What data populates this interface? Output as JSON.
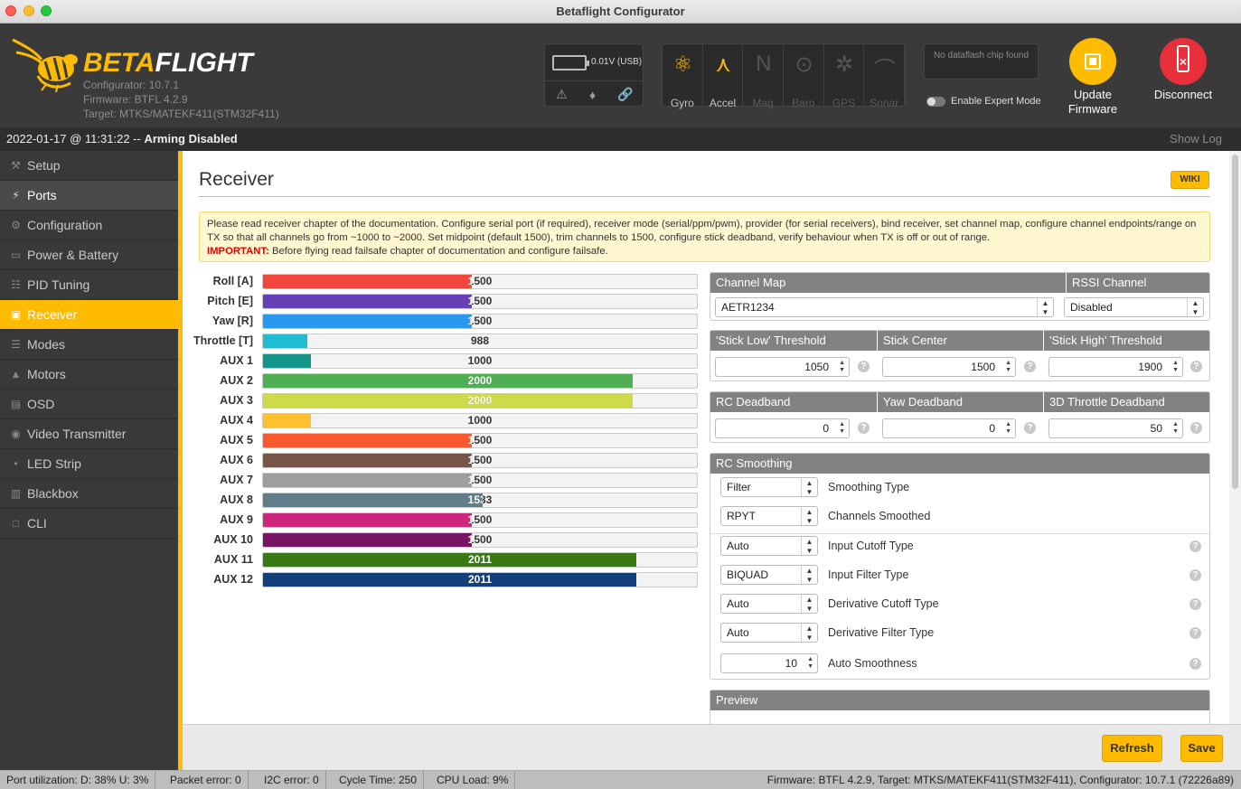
{
  "window": {
    "title": "Betaflight Configurator"
  },
  "header": {
    "brand_a": "BETA",
    "brand_b": "FLIGHT",
    "configurator": "Configurator: 10.7.1",
    "firmware": "Firmware: BTFL 4.2.9",
    "target": "Target: MTKS/MATEKF411(STM32F411)",
    "battery": "0.01V (USB)",
    "sensors": [
      {
        "label": "Gyro",
        "icon": "gyro-icon",
        "active": true
      },
      {
        "label": "Accel",
        "icon": "accel-icon",
        "active": true
      },
      {
        "label": "Mag",
        "icon": "mag-icon",
        "active": false
      },
      {
        "label": "Baro",
        "icon": "baro-icon",
        "active": false
      },
      {
        "label": "GPS",
        "icon": "gps-icon",
        "active": false
      },
      {
        "label": "Sonar",
        "icon": "sonar-icon",
        "active": false
      }
    ],
    "dataflash": "No dataflash chip found",
    "expert_mode": "Enable Expert Mode",
    "update_firmware": "Update Firmware",
    "disconnect": "Disconnect"
  },
  "status": {
    "timestamp": "2022-01-17 @ 11:31:22 --",
    "state": "Arming Disabled",
    "show_log": "Show Log"
  },
  "sidebar": {
    "items": [
      {
        "label": "Setup",
        "icon": "wrench-icon",
        "state": "normal"
      },
      {
        "label": "Ports",
        "icon": "plug-icon",
        "state": "hover"
      },
      {
        "label": "Configuration",
        "icon": "gear-icon",
        "state": "normal"
      },
      {
        "label": "Power & Battery",
        "icon": "battery-icon",
        "state": "normal"
      },
      {
        "label": "PID Tuning",
        "icon": "pid-icon",
        "state": "normal"
      },
      {
        "label": "Receiver",
        "icon": "receiver-icon",
        "state": "active"
      },
      {
        "label": "Modes",
        "icon": "modes-icon",
        "state": "normal"
      },
      {
        "label": "Motors",
        "icon": "motor-icon",
        "state": "normal"
      },
      {
        "label": "OSD",
        "icon": "osd-icon",
        "state": "normal"
      },
      {
        "label": "Video Transmitter",
        "icon": "vtx-icon",
        "state": "normal"
      },
      {
        "label": "LED Strip",
        "icon": "led-icon",
        "state": "normal"
      },
      {
        "label": "Blackbox",
        "icon": "blackbox-icon",
        "state": "normal"
      },
      {
        "label": "CLI",
        "icon": "cli-icon",
        "state": "normal"
      }
    ]
  },
  "page": {
    "title": "Receiver",
    "wiki": "WIKI",
    "note_line1": "Please read receiver chapter of the documentation. Configure serial port (if required), receiver mode (serial/ppm/pwm), provider (for serial receivers), bind receiver, set channel map, configure channel endpoints/range on TX so that all channels go from ~1000 to ~2000. Set midpoint (default 1500), trim channels to 1500, configure stick deadband, verify behaviour when TX is off or out of range.",
    "note_important": "IMPORTANT:",
    "note_line2": "Before flying read failsafe chapter of documentation and configure failsafe."
  },
  "channels": [
    {
      "label": "Roll [A]",
      "value": 1500,
      "display": "1500",
      "color": "#f1453d"
    },
    {
      "label": "Pitch [E]",
      "value": 1500,
      "display": "1500",
      "color": "#673fb4"
    },
    {
      "label": "Yaw [R]",
      "value": 1500,
      "display": "1500",
      "color": "#2b98f0"
    },
    {
      "label": "Throttle [T]",
      "value": 988,
      "display": "988",
      "color": "#1fbcd2"
    },
    {
      "label": "AUX 1",
      "value": 1000,
      "display": "1000",
      "color": "#159588"
    },
    {
      "label": "AUX 2",
      "value": 2000,
      "display": "2000",
      "color": "#50ae55"
    },
    {
      "label": "AUX 3",
      "value": 2000,
      "display": "2000",
      "color": "#cdda49"
    },
    {
      "label": "AUX 4",
      "value": 1000,
      "display": "1000",
      "color": "#fdc02f"
    },
    {
      "label": "AUX 5",
      "value": 1500,
      "display": "1500",
      "color": "#fc5830"
    },
    {
      "label": "AUX 6",
      "value": 1500,
      "display": "1500",
      "color": "#785549"
    },
    {
      "label": "AUX 7",
      "value": 1500,
      "display": "1500",
      "color": "#9e9e9e"
    },
    {
      "label": "AUX 8",
      "value": 1533,
      "display": "1533",
      "color": "#617d8a"
    },
    {
      "label": "AUX 9",
      "value": 1500,
      "display": "1500",
      "color": "#cf267d"
    },
    {
      "label": "AUX 10",
      "value": 1500,
      "display": "1500",
      "color": "#7a1464"
    },
    {
      "label": "AUX 11",
      "value": 2011,
      "display": "2011",
      "color": "#3a7a14"
    },
    {
      "label": "AUX 12",
      "value": 2011,
      "display": "2011",
      "color": "#14407a"
    }
  ],
  "channel_map": {
    "header": "Channel Map",
    "value": "AETR1234"
  },
  "rssi": {
    "header": "RSSI Channel",
    "value": "Disabled"
  },
  "stick": {
    "low_header": "'Stick Low' Threshold",
    "low": "1050",
    "center_header": "Stick Center",
    "center": "1500",
    "high_header": "'Stick High' Threshold",
    "high": "1900"
  },
  "deadband": {
    "rc_header": "RC Deadband",
    "rc": "0",
    "yaw_header": "Yaw Deadband",
    "yaw": "0",
    "throttle3d_header": "3D Throttle Deadband",
    "throttle3d": "50"
  },
  "smoothing": {
    "header": "RC Smoothing",
    "rows": [
      {
        "value": "Filter",
        "label": "Smoothing Type",
        "help": false
      },
      {
        "value": "RPYT",
        "label": "Channels Smoothed",
        "help": false
      },
      {
        "value": "Auto",
        "label": "Input Cutoff Type",
        "help": true
      },
      {
        "value": "BIQUAD",
        "label": "Input Filter Type",
        "help": true
      },
      {
        "value": "Auto",
        "label": "Derivative Cutoff Type",
        "help": true
      },
      {
        "value": "Auto",
        "label": "Derivative Filter Type",
        "help": true
      }
    ],
    "auto_smoothness_value": "10",
    "auto_smoothness_label": "Auto Smoothness"
  },
  "preview": {
    "header": "Preview"
  },
  "footer": {
    "refresh": "Refresh",
    "save": "Save"
  },
  "bottom": {
    "port_util": "Port utilization: D: 38% U: 3%",
    "packet_error": "Packet error: 0",
    "i2c_error": "I2C error: 0",
    "cycle_time": "Cycle Time: 250",
    "cpu_load": "CPU Load: 9%",
    "firmware_info": "Firmware: BTFL 4.2.9, Target: MTKS/MATEKF411(STM32F411), Configurator: 10.7.1 (72226a89)"
  }
}
